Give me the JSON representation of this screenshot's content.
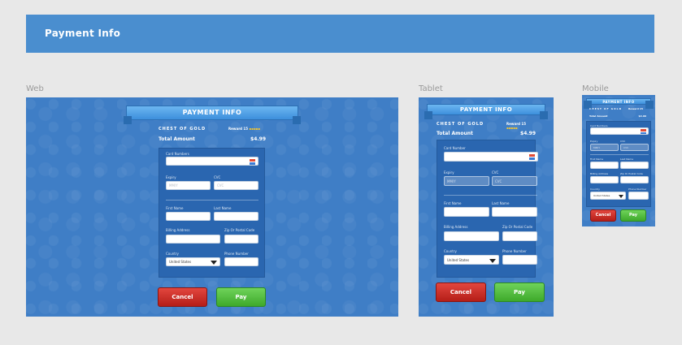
{
  "header": {
    "title": "Payment Info"
  },
  "frames": {
    "web": "Web",
    "tablet": "Tablet",
    "mobile": "Mobile"
  },
  "banner": {
    "title": "PAYMENT INFO"
  },
  "item": {
    "name": "CHEST OF GOLD",
    "reward_label": "Reward 15",
    "reward_coins": "▪▪▪▪▪"
  },
  "total": {
    "label": "Total Amount",
    "amount": "$4.99"
  },
  "form": {
    "card_number": {
      "label": "Card Numbers",
      "label_tablet": "Card Number",
      "value": ""
    },
    "expiry": {
      "label": "Expiry",
      "placeholder": "MM/Y"
    },
    "cvc": {
      "label": "CVC",
      "placeholder": "CVC"
    },
    "first_name": {
      "label": "First Name"
    },
    "last_name": {
      "label": "Last Name"
    },
    "billing_address": {
      "label": "Billing Address"
    },
    "zip": {
      "label": "Zip Or Postal Code"
    },
    "country": {
      "label": "Country",
      "value": "United States"
    },
    "phone": {
      "label": "Phone Number"
    }
  },
  "buttons": {
    "cancel": "Cancel",
    "pay": "Pay"
  },
  "colors": {
    "header": "#4a8ecf",
    "frame": "#3f7ec6",
    "panel": "#2a66b0",
    "cancel": "#c8261f",
    "pay": "#4cb83a",
    "coin": "#f4c531"
  }
}
